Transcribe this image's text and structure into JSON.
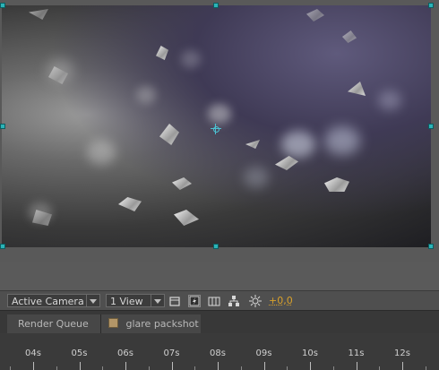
{
  "toolbar": {
    "camera_label": "Active Camera",
    "view_label": "1 View",
    "exposure_value": "+0,0"
  },
  "tabs": [
    {
      "label": "Render Queue"
    },
    {
      "label": "glare packshot"
    }
  ],
  "timeline": {
    "ticks": [
      "04s",
      "05s",
      "06s",
      "07s",
      "08s",
      "09s",
      "10s",
      "11s",
      "12s"
    ]
  },
  "colors": {
    "selection_handle": "#2bb3b7",
    "exposure": "#d9a12b",
    "comp_swatch": "#b39668"
  }
}
